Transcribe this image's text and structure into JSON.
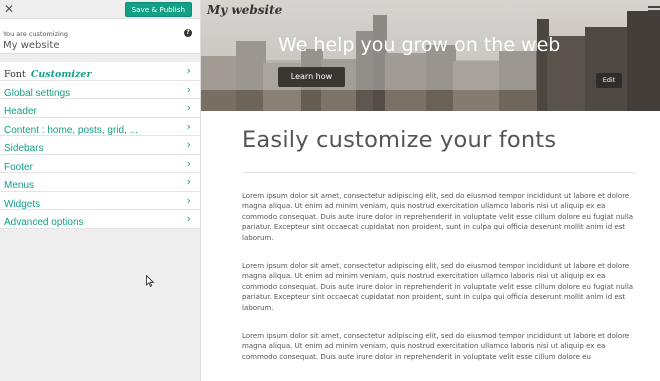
{
  "sidebar": {
    "close_icon": "close-icon",
    "publish_label": "Save & Publish",
    "customizing_label": "You are customizing",
    "site_name": "My website",
    "help_glyph": "?",
    "font_item": {
      "prefix": "Font",
      "accent": "Customizer"
    },
    "items": [
      {
        "label": "Global settings"
      },
      {
        "label": "Header"
      },
      {
        "label": "Content : home, posts, grid, ..."
      },
      {
        "label": "Sidebars"
      },
      {
        "label": "Footer"
      },
      {
        "label": "Menus"
      },
      {
        "label": "Widgets"
      },
      {
        "label": "Advanced options"
      }
    ],
    "accent_color": "#14a085"
  },
  "preview": {
    "site_title": "My website",
    "hero_heading": "We help you grow on the web",
    "learn_more": "Learn how",
    "edit": "Edit",
    "page_title": "Easily customize your fonts",
    "paragraphs": [
      "Lorem ipsum dolor sit amet, consectetur adipiscing elit, sed do eiusmod tempor incididunt ut labore et dolore magna aliqua. Ut enim ad minim veniam, quis nostrud exercitation ullamco laboris nisi ut aliquip ex ea commodo consequat. Duis aute irure dolor in reprehenderit in voluptate velit esse cillum dolore eu fugiat nulla pariatur. Excepteur sint occaecat cupidatat non proident, sunt in culpa qui officia deserunt mollit anim id est laborum.",
      "Lorem ipsum dolor sit amet, consectetur adipiscing elit, sed do eiusmod tempor incididunt ut labore et dolore magna aliqua. Ut enim ad minim veniam, quis nostrud exercitation ullamco laboris nisi ut aliquip ex ea commodo consequat. Duis aute irure dolor in reprehenderit in voluptate velit esse cillum dolore eu fugiat nulla pariatur. Excepteur sint occaecat cupidatat non proident, sunt in culpa qui officia deserunt mollit anim id est laborum.",
      "Lorem ipsum dolor sit amet, consectetur adipiscing elit, sed do eiusmod tempor incididunt ut labore et dolore magna aliqua. Ut enim ad minim veniam, quis nostrud exercitation ullamco laboris nisi ut aliquip ex ea commodo consequat. Duis aute irure dolor in reprehenderit in voluptate velit esse cillum dolore eu"
    ]
  }
}
